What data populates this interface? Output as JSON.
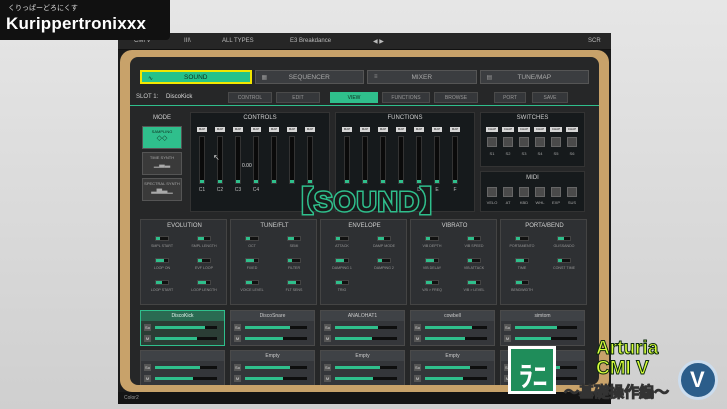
{
  "logo": {
    "kana": "くりっぱーどろにくす",
    "name": "Kurippertronixxx"
  },
  "topbar": {
    "cmi": "CMI V",
    "bars": "III\\",
    "types": "ALL TYPES",
    "preset": "E3 Breakdance",
    "zoom": "SCR"
  },
  "tabs": [
    {
      "label": "SOUND",
      "icon": "∿"
    },
    {
      "label": "SEQUENCER",
      "icon": "▦"
    },
    {
      "label": "MIXER",
      "icon": "≡"
    },
    {
      "label": "TUNE/MAP",
      "icon": "▤"
    }
  ],
  "slot": {
    "label": "SLOT 1:",
    "value": "DiscoKick"
  },
  "subtabs": [
    "CONTROL",
    "EDIT",
    "VIEW",
    "FUNCTIONS",
    "BROWSE",
    "PORT",
    "SAVE"
  ],
  "mode": {
    "title": "MODE",
    "buttons": [
      "SAMPLING",
      "TIME SYNTH",
      "SPECTRAL SYNTH"
    ]
  },
  "controls": {
    "title": "CONTROLS",
    "map": "MAP",
    "value": "0.00",
    "caps": [
      "C1",
      "C2",
      "C3",
      "C4",
      "",
      "",
      ""
    ],
    "levels": [
      0.06,
      0.06,
      0.06,
      0.06,
      0.06,
      0.06,
      0.06
    ]
  },
  "functions": {
    "title": "FUNCTIONS",
    "caps": [
      "",
      "",
      "",
      "",
      "D",
      "E",
      "F"
    ],
    "levels": [
      0.06,
      0.06,
      0.06,
      0.06,
      0.06,
      0.06,
      0.06
    ]
  },
  "switches": {
    "title": "SWITCHES",
    "labels": [
      "S1",
      "S2",
      "S3",
      "S4",
      "S5",
      "S6"
    ],
    "map": "CHAP"
  },
  "midi": {
    "title": "MIDI",
    "labels": [
      "VELO",
      "AT",
      "KBD",
      "WHL",
      "EXP",
      "SUS"
    ]
  },
  "sections": [
    {
      "title": "EVOLUTION",
      "knobs": [
        "SMPL START",
        "SMPL LENGTH",
        "LOOP ON",
        "EVF LOOP",
        "LOOP START",
        "LOOP LENGTH"
      ]
    },
    {
      "title": "TUNE/FLT",
      "knobs": [
        "OCT",
        "SEMI",
        "FIXED",
        "FILTER",
        "VOICE LEVEL",
        "FLT SENS"
      ]
    },
    {
      "title": "ENVELOPE",
      "knobs": [
        "ATTACK",
        "DAMP MODE",
        "DAMPING 1",
        "DAMPING 2",
        "TRIG"
      ]
    },
    {
      "title": "VIBRATO",
      "knobs": [
        "VIB DEPTH",
        "VIB SPEED",
        "VIB DELAY",
        "VIB ATTACK",
        "V/B > FREQ",
        "V/B > LEVEL"
      ]
    },
    {
      "title": "PORTA/BEND",
      "knobs": [
        "PORTAMENTO",
        "GLISSANDO",
        "TIME",
        "CONST TIME",
        "BENDWIDTH"
      ]
    }
  ],
  "slots": [
    {
      "name": "DiscoKick",
      "level": 0.8
    },
    {
      "name": "DiscoSnare",
      "level": 0.72
    },
    {
      "name": "ANALOHAT1",
      "level": 0.7
    },
    {
      "name": "cowbell",
      "level": 0.75
    },
    {
      "name": "simtom",
      "level": 0.68
    },
    {
      "name": "",
      "level": 0.72
    },
    {
      "name": "Empty",
      "level": 0.72
    },
    {
      "name": "Empty",
      "level": 0.72
    },
    {
      "name": "Empty",
      "level": 0.72
    },
    {
      "name": "Empty",
      "level": 0.72
    }
  ],
  "slot_buttons": {
    "solo": "So",
    "mute": "M"
  },
  "status": {
    "text": "Color2"
  },
  "overlay": {
    "caption": "【SOUND】",
    "brand_line1": "Arturia",
    "brand_line2": "CMI V",
    "brand_line3": "〜基礎操作編〜",
    "brand_mark": "ﾗﾆ"
  },
  "colors": {
    "accent": "#2fbf8c",
    "highlight": "#f2e600",
    "wood": "#c8a26a"
  }
}
